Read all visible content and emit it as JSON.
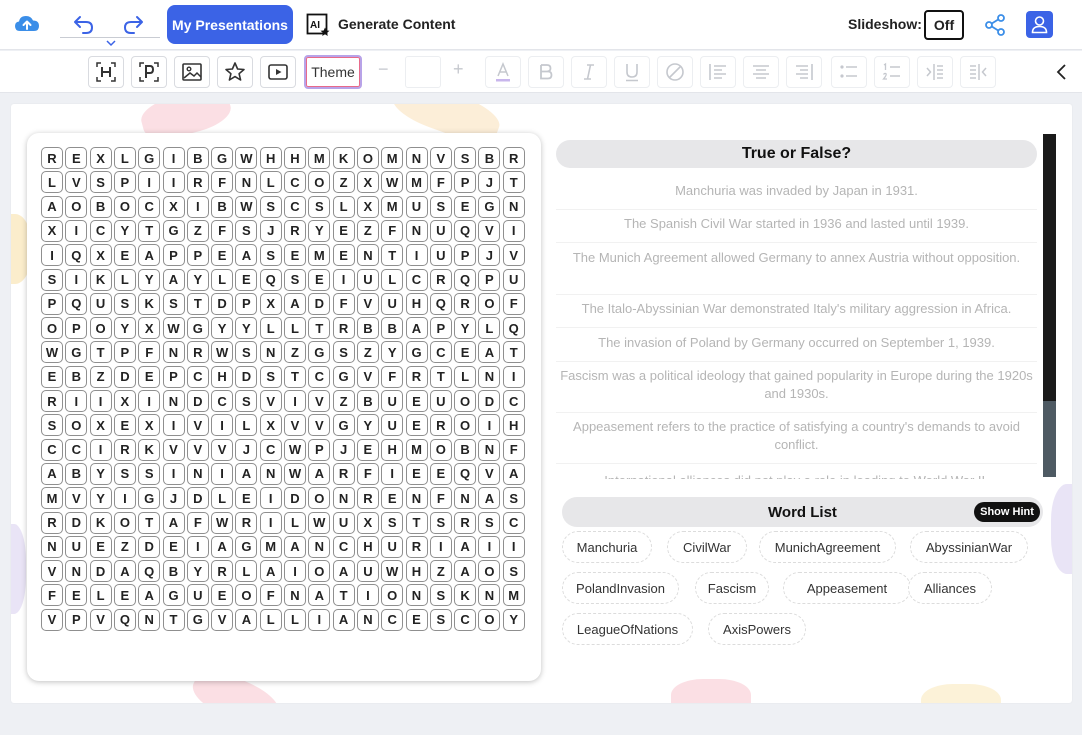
{
  "header": {
    "my_presentations": "My Presentations",
    "generate_content": "Generate Content",
    "ai_badge": "AI",
    "slideshow_label": "Slideshow:",
    "slideshow_state": "Off"
  },
  "toolbar": {
    "theme_label": "Theme",
    "font_size_value": ""
  },
  "colors": {
    "accent": "#3b63e6",
    "scrollbar": "#1a1a1a"
  },
  "word_search": {
    "grid": [
      [
        "R",
        "E",
        "X",
        "L",
        "G",
        "I",
        "B",
        "G",
        "W",
        "H",
        "H",
        "M",
        "K",
        "O",
        "M",
        "N",
        "V",
        "S",
        "B",
        "R"
      ],
      [
        "L",
        "V",
        "S",
        "P",
        "I",
        "I",
        "R",
        "F",
        "N",
        "L",
        "C",
        "O",
        "Z",
        "X",
        "W",
        "M",
        "F",
        "P",
        "J",
        "T"
      ],
      [
        "A",
        "O",
        "B",
        "O",
        "C",
        "X",
        "I",
        "B",
        "W",
        "S",
        "C",
        "S",
        "L",
        "X",
        "M",
        "U",
        "S",
        "E",
        "G",
        "N"
      ],
      [
        "X",
        "I",
        "C",
        "Y",
        "T",
        "G",
        "Z",
        "F",
        "S",
        "J",
        "R",
        "Y",
        "E",
        "Z",
        "F",
        "N",
        "U",
        "Q",
        "V",
        "I"
      ],
      [
        "I",
        "Q",
        "X",
        "E",
        "A",
        "P",
        "P",
        "E",
        "A",
        "S",
        "E",
        "M",
        "E",
        "N",
        "T",
        "I",
        "U",
        "P",
        "J",
        "V"
      ],
      [
        "S",
        "I",
        "K",
        "L",
        "Y",
        "A",
        "Y",
        "L",
        "E",
        "Q",
        "S",
        "E",
        "I",
        "U",
        "L",
        "C",
        "R",
        "Q",
        "P",
        "U"
      ],
      [
        "P",
        "Q",
        "U",
        "S",
        "K",
        "S",
        "T",
        "D",
        "P",
        "X",
        "A",
        "D",
        "F",
        "V",
        "U",
        "H",
        "Q",
        "R",
        "O",
        "F"
      ],
      [
        "O",
        "P",
        "O",
        "Y",
        "X",
        "W",
        "G",
        "Y",
        "Y",
        "L",
        "L",
        "T",
        "R",
        "B",
        "B",
        "A",
        "P",
        "Y",
        "L",
        "Q"
      ],
      [
        "W",
        "G",
        "T",
        "P",
        "F",
        "N",
        "R",
        "W",
        "S",
        "N",
        "Z",
        "G",
        "S",
        "Z",
        "Y",
        "G",
        "C",
        "E",
        "A",
        "T"
      ],
      [
        "E",
        "B",
        "Z",
        "D",
        "E",
        "P",
        "C",
        "H",
        "D",
        "S",
        "T",
        "C",
        "G",
        "V",
        "F",
        "R",
        "T",
        "L",
        "N",
        "I"
      ],
      [
        "R",
        "I",
        "I",
        "X",
        "I",
        "N",
        "D",
        "C",
        "S",
        "V",
        "I",
        "V",
        "Z",
        "B",
        "U",
        "E",
        "U",
        "O",
        "D",
        "C"
      ],
      [
        "S",
        "O",
        "X",
        "E",
        "X",
        "I",
        "V",
        "I",
        "L",
        "X",
        "V",
        "V",
        "G",
        "Y",
        "U",
        "E",
        "R",
        "O",
        "I",
        "H"
      ],
      [
        "C",
        "C",
        "I",
        "R",
        "K",
        "V",
        "V",
        "V",
        "J",
        "C",
        "W",
        "P",
        "J",
        "E",
        "H",
        "M",
        "O",
        "B",
        "N",
        "F"
      ],
      [
        "A",
        "B",
        "Y",
        "S",
        "S",
        "I",
        "N",
        "I",
        "A",
        "N",
        "W",
        "A",
        "R",
        "F",
        "I",
        "E",
        "E",
        "Q",
        "V",
        "A"
      ],
      [
        "M",
        "V",
        "Y",
        "I",
        "G",
        "J",
        "D",
        "L",
        "E",
        "I",
        "D",
        "O",
        "N",
        "R",
        "E",
        "N",
        "F",
        "N",
        "A",
        "S"
      ],
      [
        "R",
        "D",
        "K",
        "O",
        "T",
        "A",
        "F",
        "W",
        "R",
        "I",
        "L",
        "W",
        "U",
        "X",
        "S",
        "T",
        "S",
        "R",
        "S",
        "C"
      ],
      [
        "N",
        "U",
        "E",
        "Z",
        "D",
        "E",
        "I",
        "A",
        "G",
        "M",
        "A",
        "N",
        "C",
        "H",
        "U",
        "R",
        "I",
        "A",
        "I",
        "I"
      ],
      [
        "V",
        "N",
        "D",
        "A",
        "Q",
        "B",
        "Y",
        "R",
        "L",
        "A",
        "I",
        "O",
        "A",
        "U",
        "W",
        "H",
        "Z",
        "A",
        "O",
        "S"
      ],
      [
        "F",
        "E",
        "L",
        "E",
        "A",
        "G",
        "U",
        "E",
        "O",
        "F",
        "N",
        "A",
        "T",
        "I",
        "O",
        "N",
        "S",
        "K",
        "N",
        "M"
      ],
      [
        "V",
        "P",
        "V",
        "Q",
        "N",
        "T",
        "G",
        "V",
        "A",
        "L",
        "L",
        "I",
        "A",
        "N",
        "C",
        "E",
        "S",
        "C",
        "O",
        "Y"
      ]
    ]
  },
  "true_false": {
    "title": "True or False?",
    "statements": [
      "Manchuria was invaded by Japan in 1931.",
      "The Spanish Civil War started in 1936 and lasted until 1939.",
      "The Munich Agreement allowed Germany to annex Austria without opposition.",
      "The Italo-Abyssinian War demonstrated Italy's military aggression in Africa.",
      "The invasion of Poland by Germany occurred on September 1, 1939.",
      "Fascism was a political ideology that gained popularity in Europe during the 1920s and 1930s.",
      "Appeasement refers to the practice of satisfying a country's demands to avoid conflict.",
      "International alliances did not play a role in leading to World War II."
    ]
  },
  "word_list": {
    "title": "Word List",
    "hint_label": "Show Hint",
    "words": [
      "Manchuria",
      "CivilWar",
      "MunichAgreement",
      "AbyssinianWar",
      "PolandInvasion",
      "Fascism",
      "Appeasement",
      "Alliances",
      "LeagueOfNations",
      "AxisPowers"
    ]
  }
}
